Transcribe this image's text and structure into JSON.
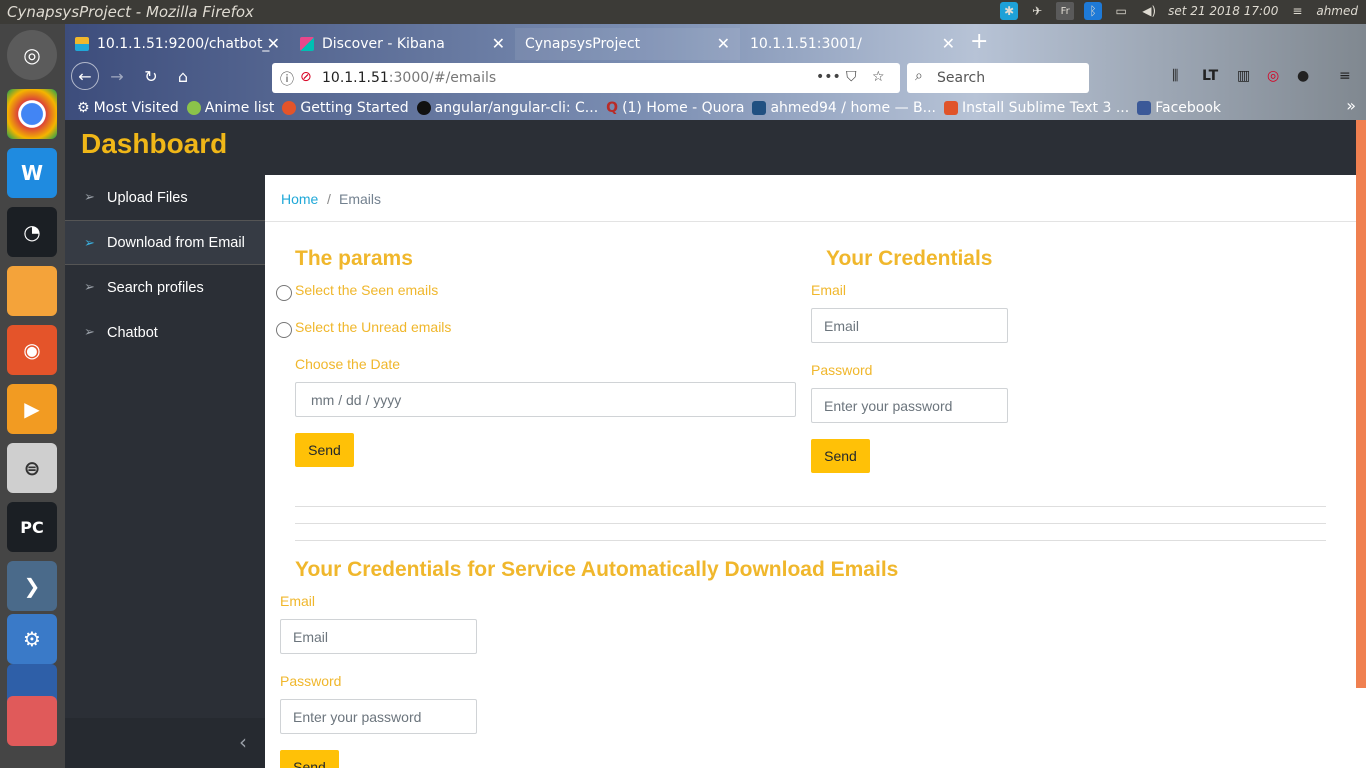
{
  "os": {
    "window_title": "CynapsysProject - Mozilla Firefox",
    "clock": "set 21 2018 17:00",
    "user": "ahmed",
    "tray_fr": "Fr"
  },
  "browser": {
    "tabs": [
      {
        "label": "10.1.1.51:9200/chatbot_",
        "icon": "elastic-icon"
      },
      {
        "label": "Discover - Kibana",
        "icon": "kibana-icon"
      },
      {
        "label": "CynapsysProject",
        "icon": ""
      },
      {
        "label": "10.1.1.51:3001/",
        "icon": ""
      }
    ],
    "url_host": "10.1.1.51",
    "url_rest": ":3000/#/emails",
    "search_placeholder": "Search",
    "toolbar_lt": "LT",
    "bookmarks": [
      "Most Visited",
      "Anime list",
      "Getting Started",
      "angular/angular-cli: C...",
      "(1) Home - Quora",
      "ahmed94 / home — B...",
      "Install Sublime Text 3 ...",
      "Facebook"
    ]
  },
  "app": {
    "brand": "Dashboard",
    "sidebar": [
      {
        "label": "Upload Files",
        "active": false
      },
      {
        "label": "Download from Email",
        "active": true
      },
      {
        "label": "Search profiles",
        "active": false
      },
      {
        "label": "Chatbot",
        "active": false
      }
    ],
    "breadcrumb": {
      "home": "Home",
      "sep": "/",
      "current": "Emails"
    }
  },
  "params": {
    "title": "The params",
    "radio_seen": "Select the Seen emails",
    "radio_unread": "Select the Unread emails",
    "date_label": "Choose the Date",
    "date_placeholder": "mm / dd / yyyy",
    "send": "Send"
  },
  "credentials": {
    "title": "Your Credentials",
    "email_label": "Email",
    "email_placeholder": "Email",
    "password_label": "Password",
    "password_placeholder": "Enter your password",
    "send": "Send"
  },
  "auto": {
    "title": "Your Credentials for Service Automatically Download Emails",
    "email_label": "Email",
    "email_placeholder": "Email",
    "password_label": "Password",
    "password_placeholder": "Enter your password",
    "send": "Send"
  },
  "colors": {
    "accent": "#f0b72c",
    "button": "#ffc107",
    "sidebar_bg": "#2b2f36",
    "link": "#20a8d8"
  }
}
